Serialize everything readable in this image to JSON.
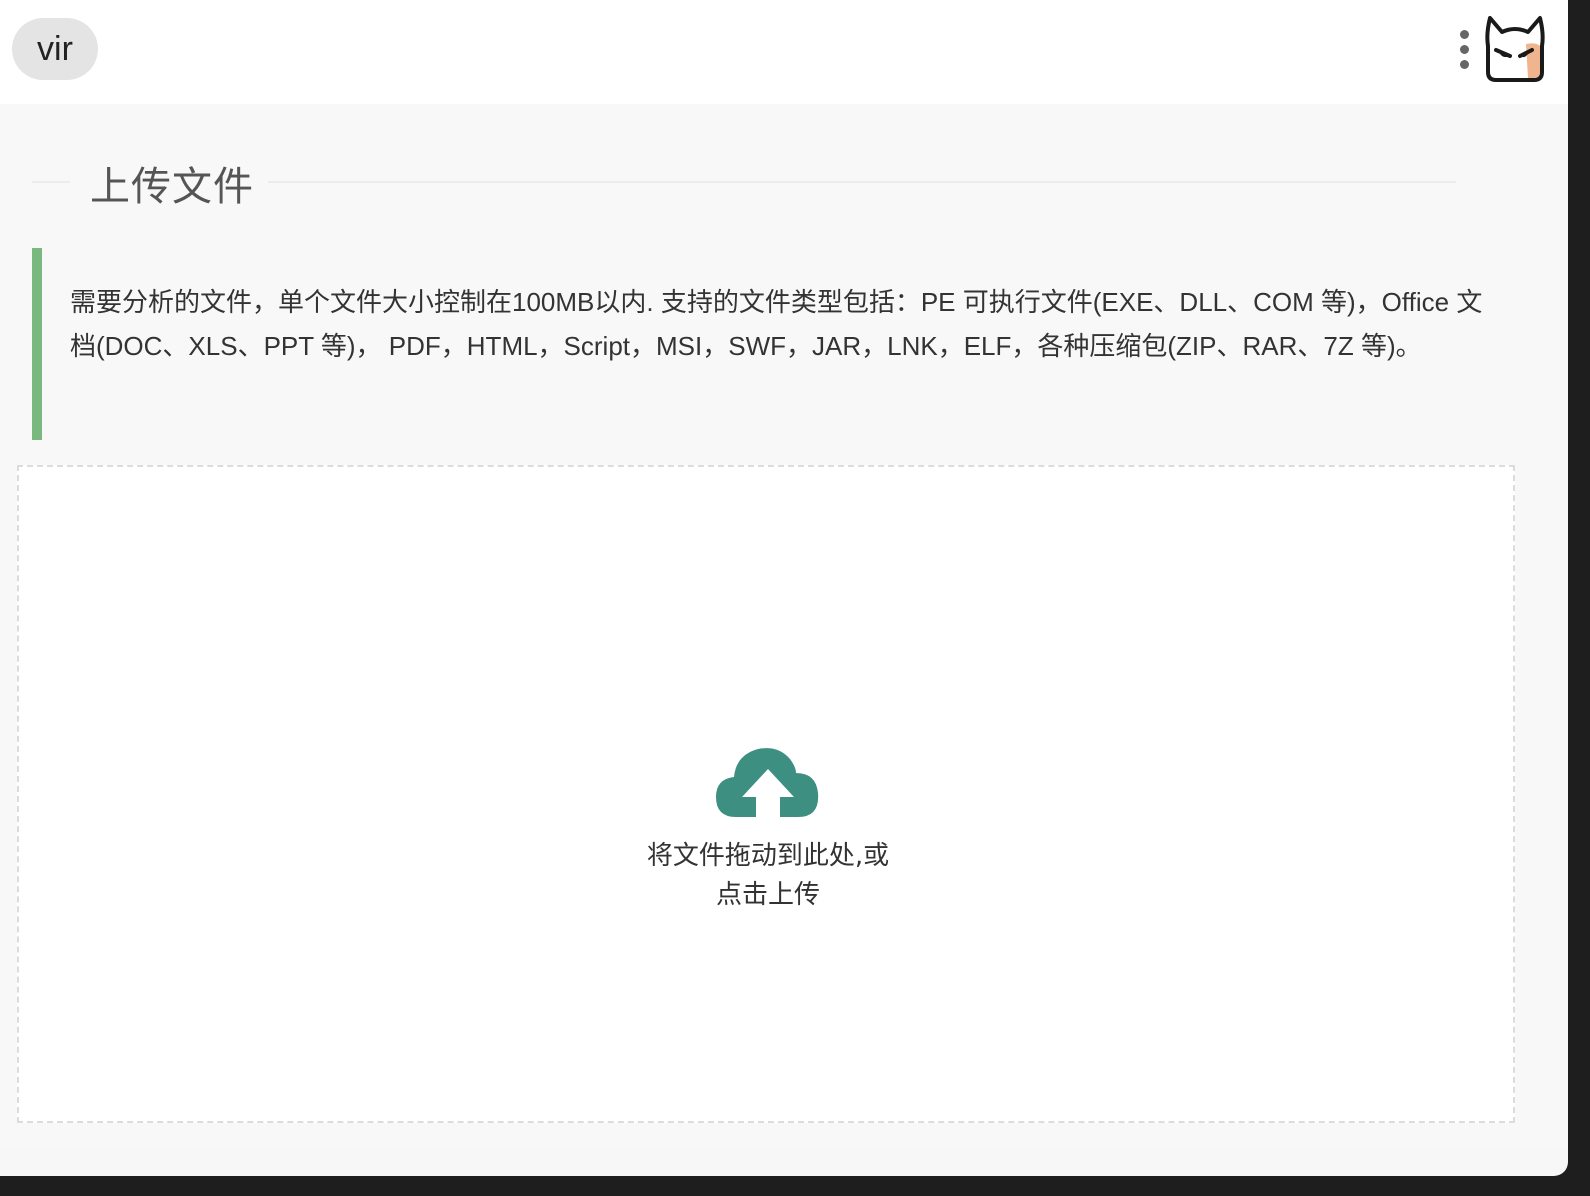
{
  "header": {
    "workspace_chip": "vir",
    "menu_icon": "more-vertical-icon",
    "avatar_icon": "cat-avatar-icon"
  },
  "section": {
    "title": "上传文件"
  },
  "notice": {
    "text": "需要分析的文件，单个文件大小控制在100MB以内. 支持的文件类型包括：PE 可执行文件(EXE、DLL、COM 等)，Office 文档(DOC、XLS、PPT 等)， PDF，HTML，Script，MSI，SWF，JAR，LNK，ELF，各种压缩包(ZIP、RAR、7Z 等)。"
  },
  "dropzone": {
    "icon": "cloud-upload-icon",
    "line1": "将文件拖动到此处,或",
    "line2": "点击上传"
  },
  "colors": {
    "accent_green": "#79b97f",
    "upload_icon": "#3d8f82",
    "text": "#333333"
  }
}
